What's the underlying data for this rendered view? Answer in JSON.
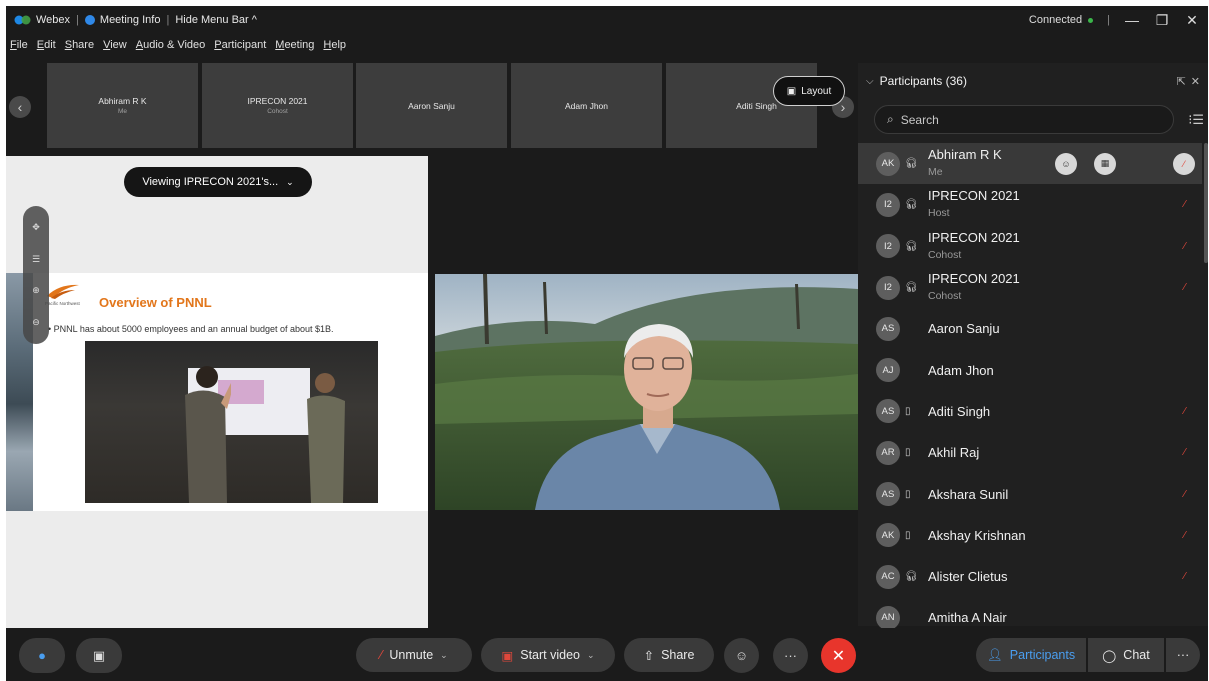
{
  "titlebar": {
    "app_name": "Webex",
    "meeting_info": "Meeting Info",
    "hide_menu": "Hide Menu Bar ^",
    "status": "Connected"
  },
  "menu": [
    "File",
    "Edit",
    "Share",
    "View",
    "Audio & Video",
    "Participant",
    "Meeting",
    "Help"
  ],
  "thumbnails": [
    {
      "name": "Abhiram R K",
      "role": "Me"
    },
    {
      "name": "IPRECON 2021",
      "role": "Cohost"
    },
    {
      "name": "Aaron Sanju",
      "role": ""
    },
    {
      "name": "Adam Jhon",
      "role": ""
    },
    {
      "name": "Aditi Singh",
      "role": ""
    }
  ],
  "layout_label": "Layout",
  "viewing_label": "Viewing IPRECON 2021's...",
  "slide": {
    "logo_text": "Pacific Northwest",
    "title": "Overview of PNNL",
    "bullet": "PNNL has about 5000 employees and an annual budget of about $1B."
  },
  "participants_panel": {
    "title": "Participants (36)",
    "search_placeholder": "Search",
    "people": [
      {
        "initials": "AK",
        "name": "Abhiram R K",
        "role": "Me",
        "device": "headset",
        "muted": true,
        "selected": true
      },
      {
        "initials": "I2",
        "name": "IPRECON 2021",
        "role": "Host",
        "device": "headset",
        "muted": true
      },
      {
        "initials": "I2",
        "name": "IPRECON 2021",
        "role": "Cohost",
        "device": "headset",
        "muted": true
      },
      {
        "initials": "I2",
        "name": "IPRECON 2021",
        "role": "Cohost",
        "device": "headset",
        "muted": true
      },
      {
        "initials": "AS",
        "name": "Aaron Sanju",
        "role": "",
        "device": "",
        "muted": false
      },
      {
        "initials": "AJ",
        "name": "Adam Jhon",
        "role": "",
        "device": "",
        "muted": false
      },
      {
        "initials": "AS",
        "name": "Aditi Singh",
        "role": "",
        "device": "phone",
        "muted": true
      },
      {
        "initials": "AR",
        "name": "Akhil Raj",
        "role": "",
        "device": "phone",
        "muted": true
      },
      {
        "initials": "AS",
        "name": "Akshara Sunil",
        "role": "",
        "device": "phone",
        "muted": true
      },
      {
        "initials": "AK",
        "name": "Akshay Krishnan",
        "role": "",
        "device": "phone",
        "muted": true
      },
      {
        "initials": "AC",
        "name": "Alister Clietus",
        "role": "",
        "device": "headset",
        "muted": true
      },
      {
        "initials": "AN",
        "name": "Amitha A Nair",
        "role": "",
        "device": "",
        "muted": false
      }
    ]
  },
  "controls": {
    "unmute": "Unmute",
    "start_video": "Start video",
    "share": "Share",
    "participants": "Participants",
    "chat": "Chat"
  },
  "colors": {
    "accent_blue": "#4a9ef0",
    "mute_red": "#e0473b",
    "end_call": "#e8352c",
    "slide_title": "#e2761b"
  }
}
